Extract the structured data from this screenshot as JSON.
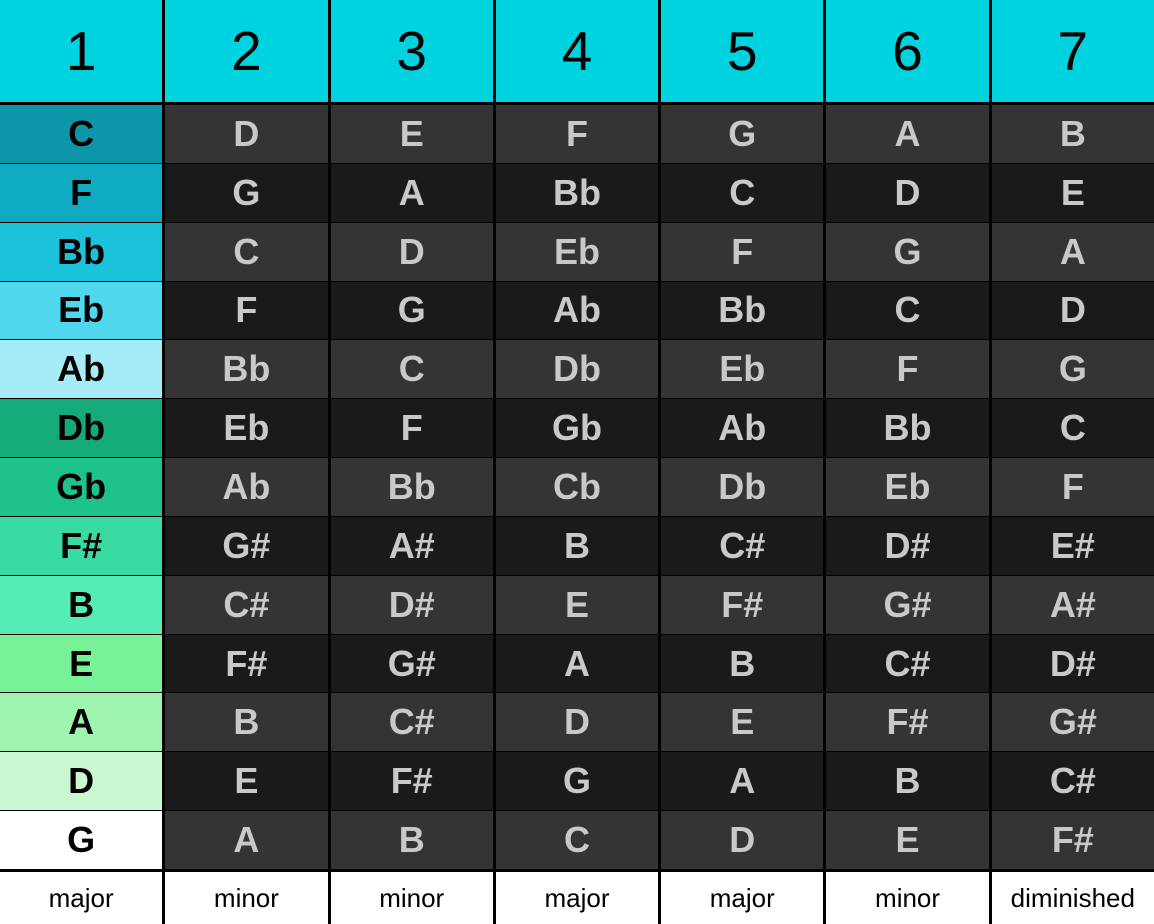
{
  "chart_data": {
    "type": "table",
    "title": "",
    "header": [
      "1",
      "2",
      "3",
      "4",
      "5",
      "6",
      "7"
    ],
    "footer": [
      "major",
      "minor",
      "minor",
      "major",
      "major",
      "minor",
      "diminished"
    ],
    "rows": [
      {
        "key": "C",
        "color": "#0d96a7",
        "notes": [
          "D",
          "E",
          "F",
          "G",
          "A",
          "B"
        ]
      },
      {
        "key": "F",
        "color": "#0facc1",
        "notes": [
          "G",
          "A",
          "Bb",
          "C",
          "D",
          "E"
        ]
      },
      {
        "key": "Bb",
        "color": "#1bc2da",
        "notes": [
          "C",
          "D",
          "Eb",
          "F",
          "G",
          "A"
        ]
      },
      {
        "key": "Eb",
        "color": "#4fd7ed",
        "notes": [
          "F",
          "G",
          "Ab",
          "Bb",
          "C",
          "D"
        ]
      },
      {
        "key": "Ab",
        "color": "#a6ecf7",
        "notes": [
          "Bb",
          "C",
          "Db",
          "Eb",
          "F",
          "G"
        ]
      },
      {
        "key": "Db",
        "color": "#14aa79",
        "notes": [
          "Eb",
          "F",
          "Gb",
          "Ab",
          "Bb",
          "C"
        ]
      },
      {
        "key": "Gb",
        "color": "#1ec28c",
        "notes": [
          "Ab",
          "Bb",
          "Cb",
          "Db",
          "Eb",
          "F"
        ]
      },
      {
        "key": "F#",
        "color": "#39dba3",
        "notes": [
          "G#",
          "A#",
          "B",
          "C#",
          "D#",
          "E#"
        ]
      },
      {
        "key": "B",
        "color": "#55edb4",
        "notes": [
          "C#",
          "D#",
          "E",
          "F#",
          "G#",
          "A#"
        ]
      },
      {
        "key": "E",
        "color": "#77f296",
        "notes": [
          "F#",
          "G#",
          "A",
          "B",
          "C#",
          "D#"
        ]
      },
      {
        "key": "A",
        "color": "#9ff4af",
        "notes": [
          "B",
          "C#",
          "D",
          "E",
          "F#",
          "G#"
        ]
      },
      {
        "key": "D",
        "color": "#c9f7cf",
        "notes": [
          "E",
          "F#",
          "G",
          "A",
          "B",
          "C#"
        ]
      },
      {
        "key": "G",
        "color": "#ffffff",
        "notes": [
          "A",
          "B",
          "C",
          "D",
          "E",
          "F#"
        ]
      }
    ]
  }
}
